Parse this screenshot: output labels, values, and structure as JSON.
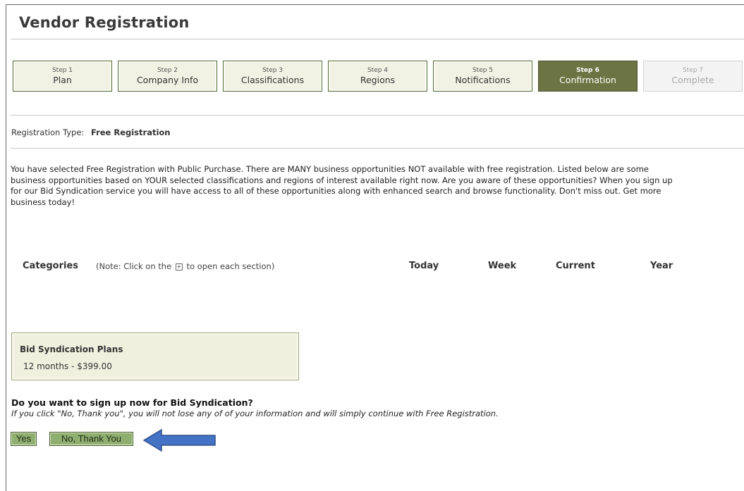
{
  "page": {
    "title": "Vendor Registration"
  },
  "steps": [
    {
      "num": "Step 1",
      "label": "Plan"
    },
    {
      "num": "Step 2",
      "label": "Company Info"
    },
    {
      "num": "Step 3",
      "label": "Classifications"
    },
    {
      "num": "Step 4",
      "label": "Regions"
    },
    {
      "num": "Step 5",
      "label": "Notifications"
    },
    {
      "num": "Step 6",
      "label": "Confirmation"
    },
    {
      "num": "Step 7",
      "label": "Complete"
    }
  ],
  "registration": {
    "label": "Registration Type:",
    "value": "Free Registration"
  },
  "intro_text": "You have selected Free Registration with Public Purchase. There are MANY business opportunities NOT available with free registration. Listed below are some business opportunities based on YOUR selected classifications and regions of interest available right now. Are you aware of these opportunities? When you sign up for our Bid Syndication service you will have access to all of these opportunities along with enhanced search and browse functionality. Don't miss out. Get more business today!",
  "categories": {
    "title": "Categories",
    "note_before": "(Note: Click on the",
    "note_after": "to open each section)",
    "columns": [
      "Today",
      "Week",
      "Current",
      "Year"
    ]
  },
  "plans": {
    "title": "Bid Syndication Plans",
    "item": "12 months - $399.00"
  },
  "signup": {
    "question": "Do you want to sign up now for Bid Syndication?",
    "note": "If you click \"No, Thank you\", you will not lose any of of your information and will simply continue with Free Registration.",
    "yes_label": "Yes",
    "no_label": "No, Thank You"
  },
  "colors": {
    "step_active": "#6b7442",
    "step_border": "#4f6b34",
    "button_bg": "#8faf71",
    "arrow": "#4472c4"
  }
}
